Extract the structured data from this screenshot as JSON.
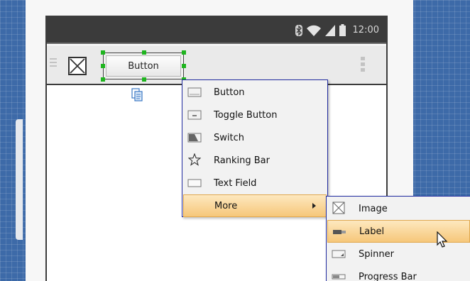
{
  "status_bar": {
    "time": "12:00",
    "icons": [
      "bluetooth-icon",
      "wifi-icon",
      "signal-icon",
      "battery-icon"
    ]
  },
  "action_bar": {
    "button_label": "Button",
    "icons": [
      "hamburger-icon",
      "image-placeholder-icon",
      "overflow-menu-icon"
    ]
  },
  "context_menu": {
    "items": [
      {
        "label": "Button",
        "icon": "button-icon"
      },
      {
        "label": "Toggle Button",
        "icon": "toggle-button-icon"
      },
      {
        "label": "Switch",
        "icon": "switch-icon"
      },
      {
        "label": "Ranking Bar",
        "icon": "star-icon"
      },
      {
        "label": "Text Field",
        "icon": "text-field-icon"
      },
      {
        "label": "More",
        "icon": "",
        "highlighted": true,
        "has_submenu": true
      }
    ]
  },
  "submenu": {
    "items": [
      {
        "label": "Image",
        "icon": "image-icon"
      },
      {
        "label": "Label",
        "icon": "label-icon",
        "highlighted": true
      },
      {
        "label": "Spinner",
        "icon": "spinner-icon"
      },
      {
        "label": "Progress Bar",
        "icon": "progress-bar-icon"
      }
    ]
  },
  "colors": {
    "highlight": "#f6c77a",
    "menu_border": "#1f2aa0",
    "selection_handle": "#1fb51f",
    "status_bar": "#3b3b3b",
    "canvas_grid": "#3d6aa8"
  }
}
